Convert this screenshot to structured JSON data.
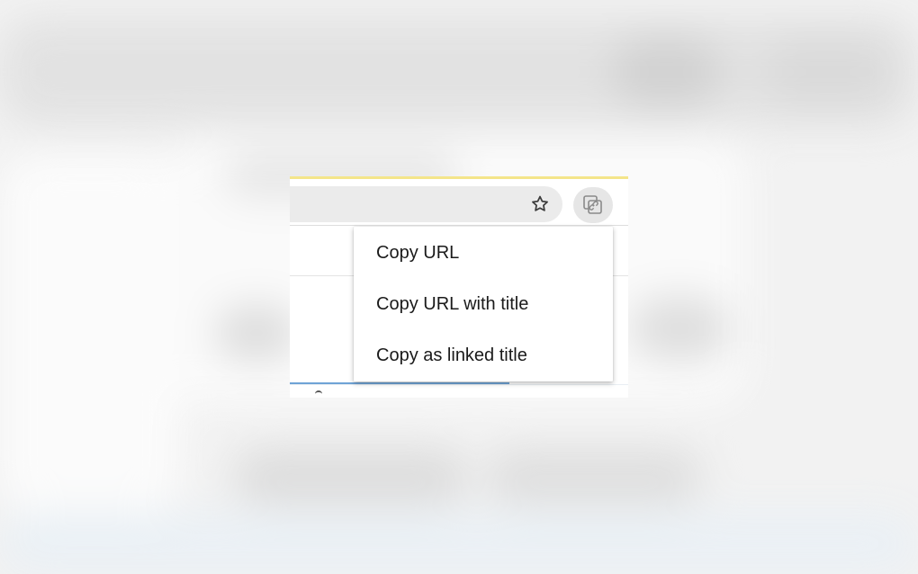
{
  "toolbar": {
    "bookmark_icon": "star-outline-icon",
    "extension_icon": "copy-link-icon"
  },
  "context_menu": {
    "items": [
      {
        "label": "Copy URL"
      },
      {
        "label": "Copy URL with title"
      },
      {
        "label": "Copy as linked title"
      }
    ]
  },
  "colors": {
    "menu_background": "#ffffff",
    "menu_text": "#1a1a1a",
    "omnibox_background": "#ebebeb",
    "accent_blue": "#6fa3d6",
    "highlight_yellow": "#f4e58a"
  }
}
